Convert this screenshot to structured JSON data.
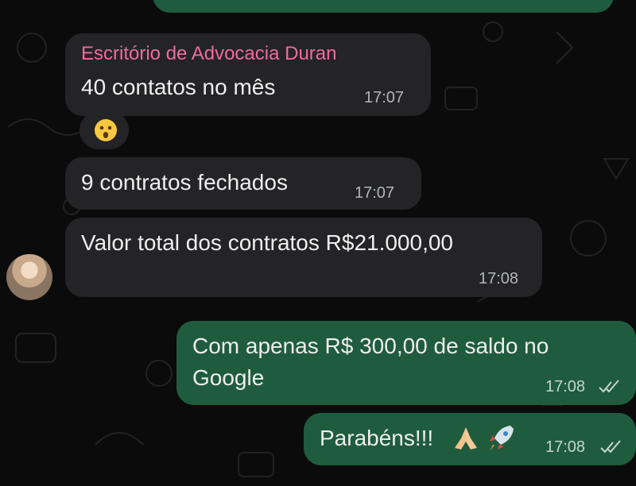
{
  "chat": {
    "group_sender": "Escritório de Advocacia Duran",
    "messages": [
      {
        "text": "40 contatos no mês",
        "time": "17:07"
      },
      {
        "emoji": "astonished-face"
      },
      {
        "text": "9 contratos fechados",
        "time": "17:07"
      },
      {
        "text": "Valor total dos contratos R$21.000,00",
        "time": "17:08"
      },
      {
        "text": "Com apenas R$ 300,00 de saldo no Google",
        "time": "17:08"
      },
      {
        "text": "Parabéns!!!",
        "time": "17:08",
        "emoji": [
          "folded-hands",
          "rocket"
        ]
      }
    ]
  },
  "colors": {
    "background": "#0b0b0b",
    "incoming_bubble": "#242426",
    "outgoing_bubble": "#1f5c3d",
    "sender_name": "#f06a9f"
  }
}
